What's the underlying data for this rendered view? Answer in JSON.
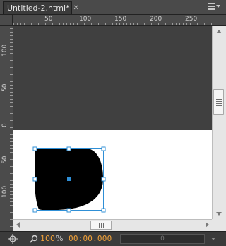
{
  "document": {
    "tab_title": "Untitled-2.html*",
    "tab_close_icon": "close-icon",
    "panel_menu_icon": "panel-menu-icon"
  },
  "rulers": {
    "horizontal_labels": [
      "50",
      "100",
      "150",
      "200",
      "250"
    ],
    "vertical_labels_top": [
      "100",
      "50",
      "0"
    ],
    "vertical_labels_bottom": [
      "50",
      "100"
    ]
  },
  "canvas": {
    "dark_background": "#404040",
    "page_background": "#ffffff",
    "shape_fill": "#000000",
    "selection_color": "#2f8fd6"
  },
  "statusbar": {
    "zoom_value": "100",
    "zoom_unit": "%",
    "timecode": "00:00.000",
    "frame_value": "0",
    "accent_color": "#f0a13a"
  }
}
